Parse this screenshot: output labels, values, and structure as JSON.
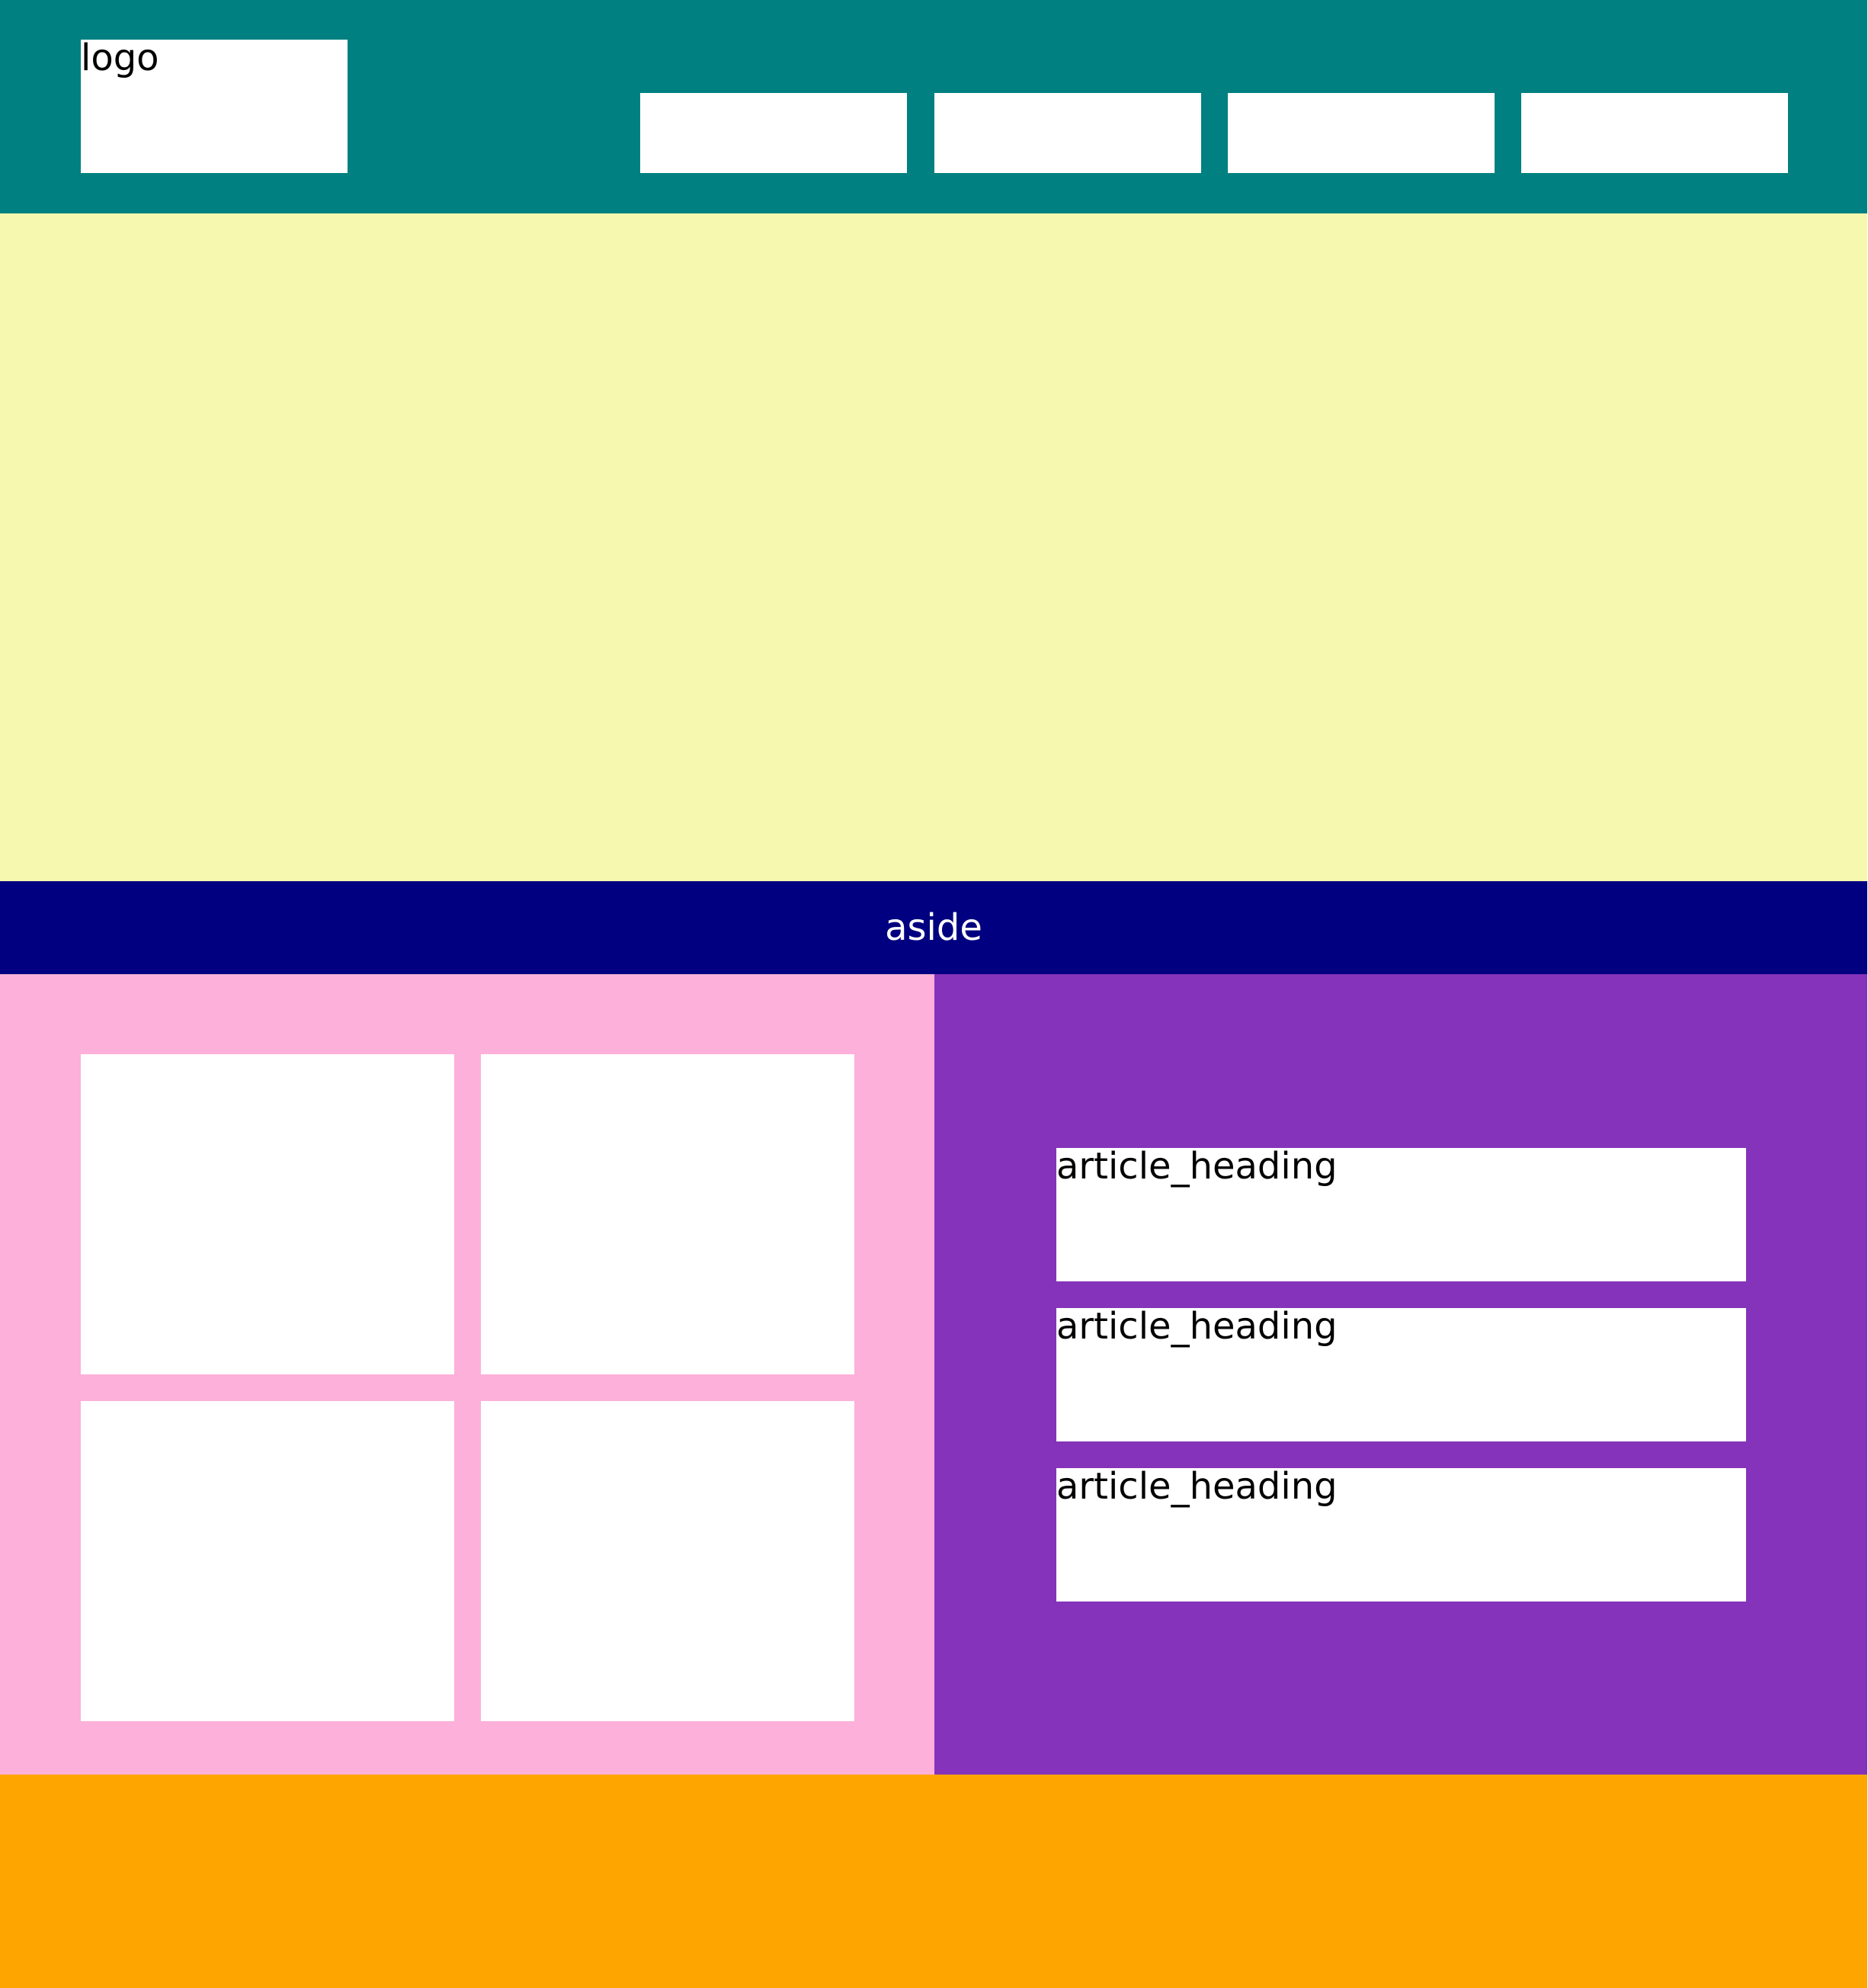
{
  "header": {
    "logo_label": "logo",
    "nav_items": [
      "",
      "",
      "",
      ""
    ],
    "background_color": "#008080"
  },
  "hero": {
    "background_color": "#f7f8af"
  },
  "aside": {
    "label": "aside",
    "background_color": "#000080"
  },
  "gallery": {
    "tiles": [
      "",
      "",
      "",
      ""
    ],
    "background_color": "#fdb0d9"
  },
  "articles": {
    "items": [
      {
        "heading": "article_heading"
      },
      {
        "heading": "article_heading"
      },
      {
        "heading": "article_heading"
      }
    ],
    "background_color": "#8533ba"
  },
  "footer": {
    "background_color": "#ffa500"
  }
}
